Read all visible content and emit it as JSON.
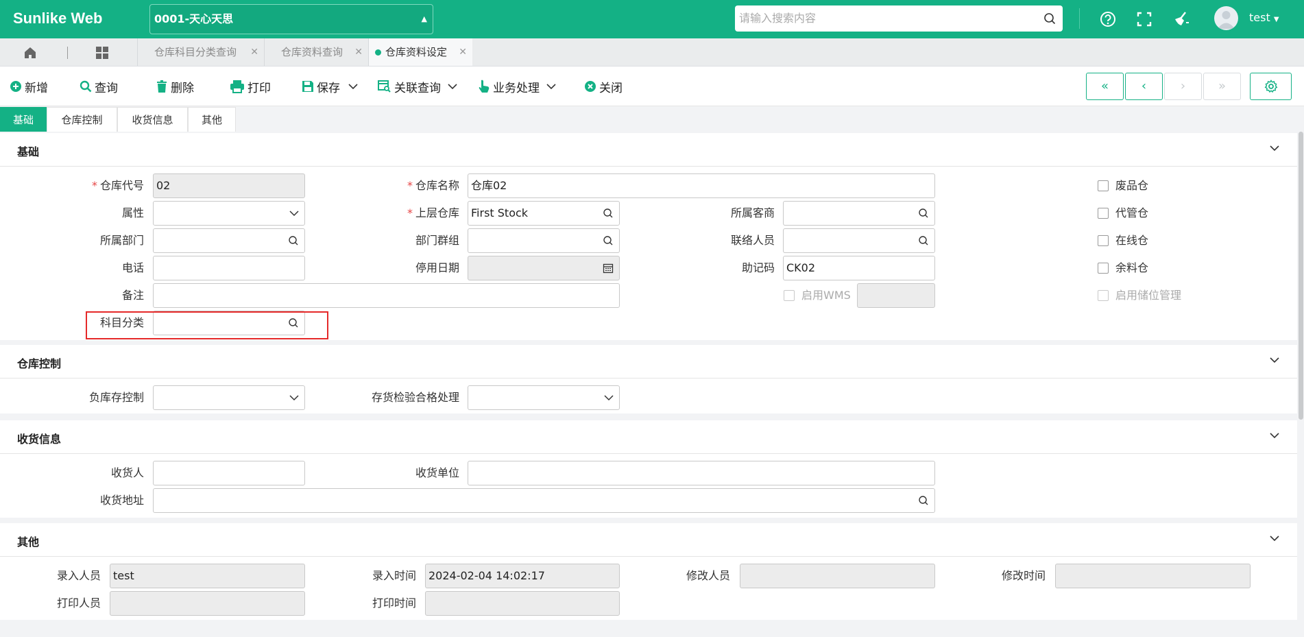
{
  "app": {
    "logo": "Sunlike Web",
    "company": "0001-天心天思",
    "search_placeholder": "请输入搜索内容",
    "user": "test",
    "accent": "#14b185"
  },
  "tabs": [
    {
      "label": "仓库科目分类查询",
      "active": false
    },
    {
      "label": "仓库资料查询",
      "active": false
    },
    {
      "label": "仓库资料设定",
      "active": true
    }
  ],
  "toolbar": {
    "add": "新增",
    "query": "查询",
    "delete": "删除",
    "print": "打印",
    "save": "保存",
    "related": "关联查询",
    "business": "业务处理",
    "close": "关闭"
  },
  "form_tabs": [
    "基础",
    "仓库控制",
    "收货信息",
    "其他"
  ],
  "basic": {
    "title": "基础",
    "warehouse_code_label": "仓库代号",
    "warehouse_code": "02",
    "warehouse_name_label": "仓库名称",
    "warehouse_name": "仓库02",
    "attribute_label": "属性",
    "attribute": "",
    "parent_label": "上层仓库",
    "parent": "First Stock",
    "customer_label": "所属客商",
    "customer": "",
    "dept_label": "所属部门",
    "dept": "",
    "dept_group_label": "部门群组",
    "dept_group": "",
    "contact_label": "联络人员",
    "contact": "",
    "phone_label": "电话",
    "phone": "",
    "disable_date_label": "停用日期",
    "disable_date": "",
    "mnemonic_label": "助记码",
    "mnemonic": "CK02",
    "remark_label": "备注",
    "remark": "",
    "enable_wms_label": "启用WMS",
    "wms_value": "",
    "subject_category_label": "科目分类",
    "subject_category": "",
    "checks": [
      {
        "label": "废品仓",
        "checked": false,
        "disabled": false
      },
      {
        "label": "代管仓",
        "checked": false,
        "disabled": false
      },
      {
        "label": "在线仓",
        "checked": false,
        "disabled": false
      },
      {
        "label": "余料仓",
        "checked": false,
        "disabled": false
      },
      {
        "label": "启用储位管理",
        "checked": false,
        "disabled": true
      }
    ]
  },
  "control": {
    "title": "仓库控制",
    "neg_stock_label": "负库存控制",
    "neg_stock": "",
    "inspect_label": "存货检验合格处理",
    "inspect": ""
  },
  "receive": {
    "title": "收货信息",
    "receiver_label": "收货人",
    "receiver": "",
    "unit_label": "收货单位",
    "unit": "",
    "address_label": "收货地址",
    "address": ""
  },
  "other": {
    "title": "其他",
    "entry_user_label": "录入人员",
    "entry_user": "test",
    "entry_time_label": "录入时间",
    "entry_time": "2024-02-04 14:02:17",
    "modify_user_label": "修改人员",
    "modify_user": "",
    "modify_time_label": "修改时间",
    "modify_time": "",
    "print_user_label": "打印人员",
    "print_user": "",
    "print_time_label": "打印时间",
    "print_time": ""
  }
}
